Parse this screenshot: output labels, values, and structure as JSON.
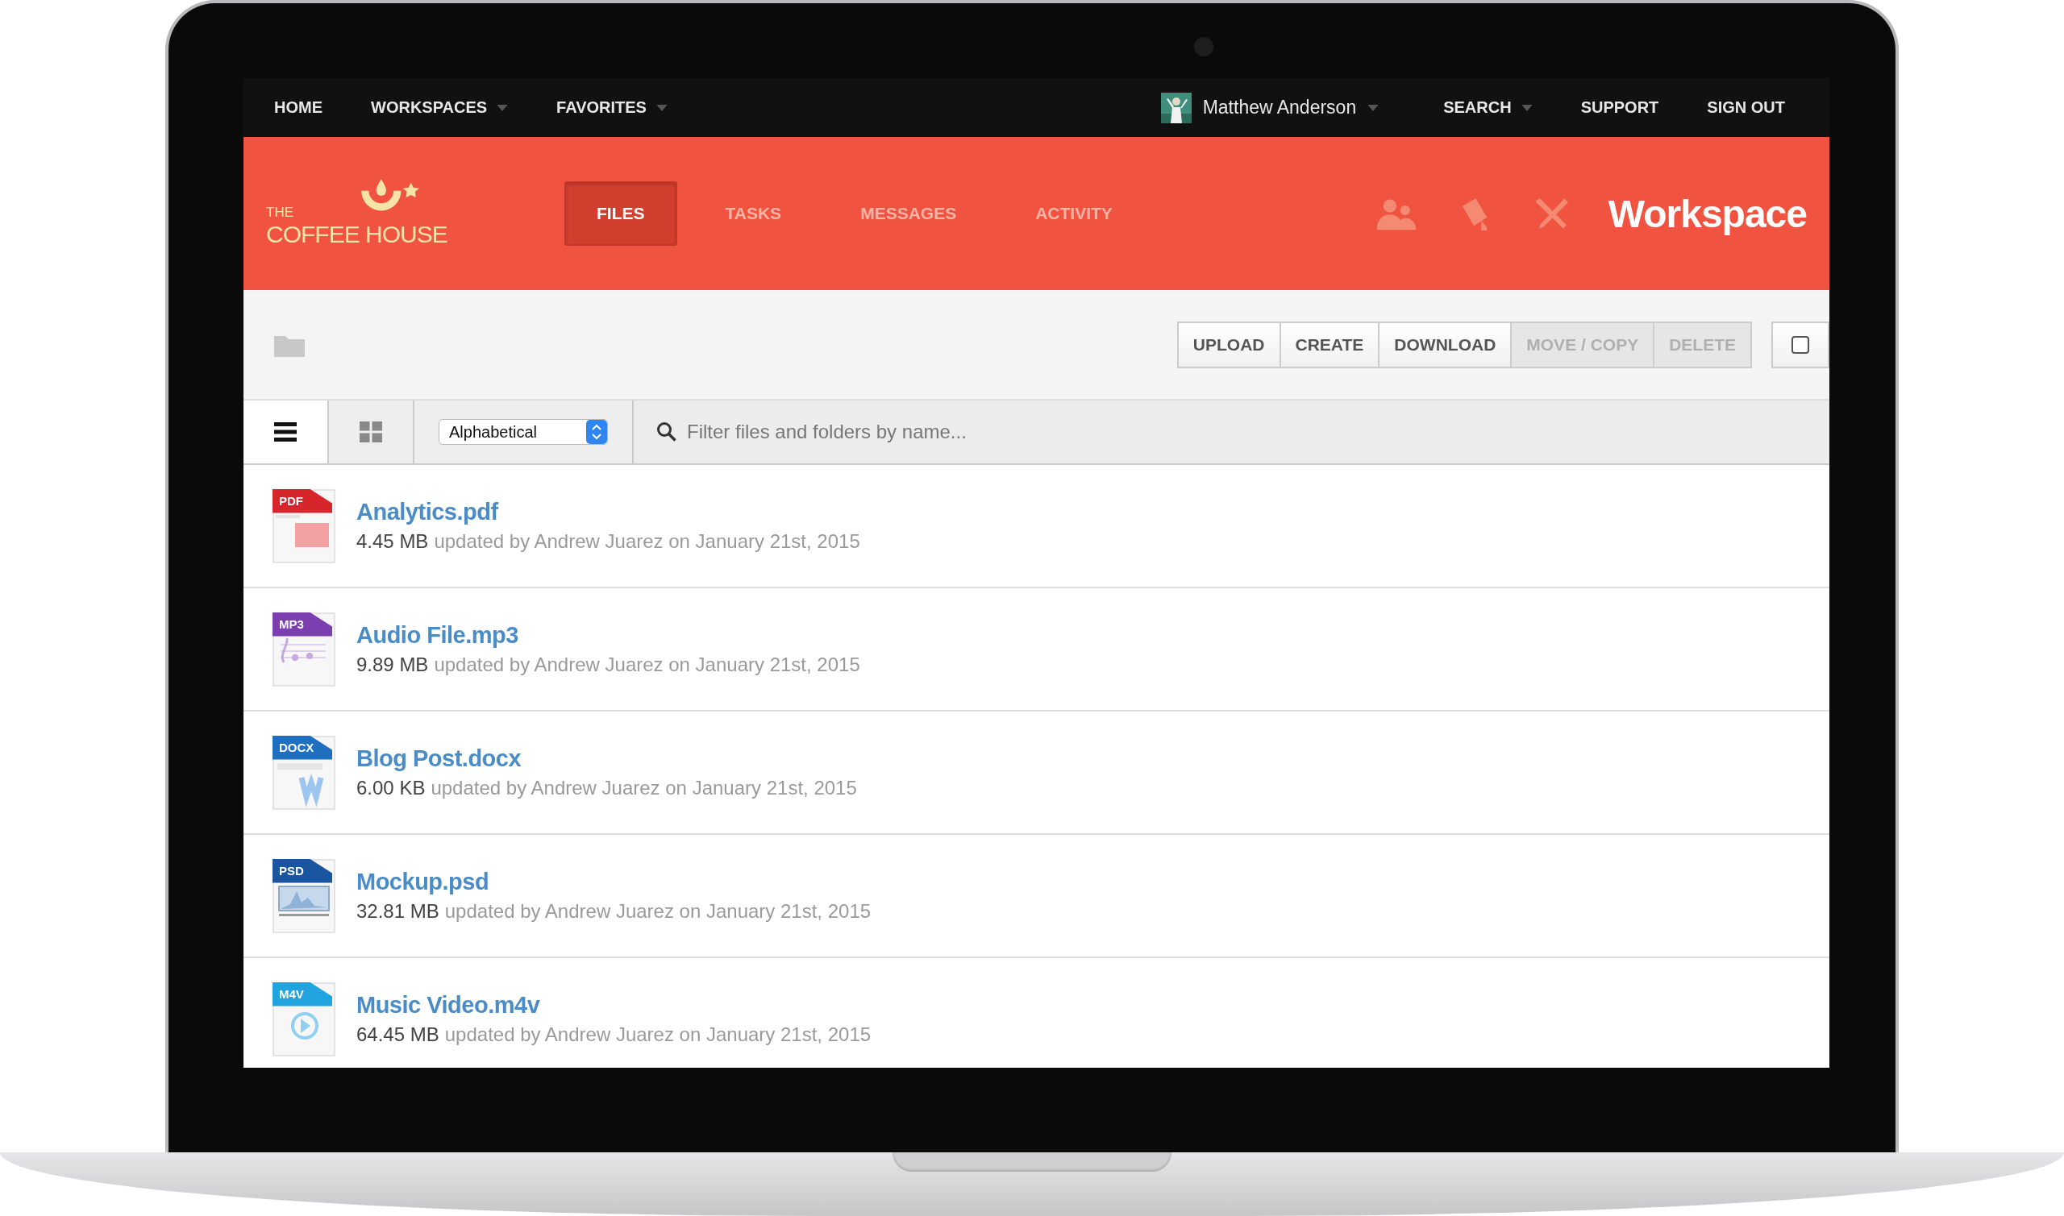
{
  "nav": {
    "left": [
      {
        "label": "HOME",
        "dropdown": false
      },
      {
        "label": "WORKSPACES",
        "dropdown": true
      },
      {
        "label": "FAVORITES",
        "dropdown": true
      }
    ],
    "user": {
      "name": "Matthew Anderson"
    },
    "right": [
      {
        "label": "SEARCH",
        "dropdown": true
      },
      {
        "label": "SUPPORT",
        "dropdown": false
      },
      {
        "label": "SIGN OUT",
        "dropdown": false
      }
    ]
  },
  "brand": {
    "prefix": "THE",
    "name": "COFFEE HOUSE"
  },
  "tabs": [
    {
      "label": "FILES",
      "selected": true
    },
    {
      "label": "TASKS",
      "selected": false
    },
    {
      "label": "MESSAGES",
      "selected": false
    },
    {
      "label": "ACTIVITY",
      "selected": false
    }
  ],
  "workspace_title": "Workspace",
  "actions": [
    {
      "label": "UPLOAD",
      "disabled": false
    },
    {
      "label": "CREATE",
      "disabled": false
    },
    {
      "label": "DOWNLOAD",
      "disabled": false
    },
    {
      "label": "MOVE / COPY",
      "disabled": true
    },
    {
      "label": "DELETE",
      "disabled": true
    }
  ],
  "select_all": {
    "checked": false
  },
  "views": [
    {
      "kind": "list",
      "selected": true
    },
    {
      "kind": "grid",
      "selected": false
    }
  ],
  "sort": {
    "value": "Alphabetical"
  },
  "filter": {
    "placeholder": "Filter files and folders by name..."
  },
  "files": [
    {
      "kind": "pdf",
      "type_label": "PDF",
      "color": "#d7262b",
      "name": "Analytics.pdf",
      "size": "4.45 MB",
      "meta": "updated by Andrew Juarez on January 21st, 2015"
    },
    {
      "kind": "mp3",
      "type_label": "MP3",
      "color": "#7b3fb0",
      "name": "Audio File.mp3",
      "size": "9.89 MB",
      "meta": "updated by Andrew Juarez on January 21st, 2015"
    },
    {
      "kind": "docx",
      "type_label": "DOCX",
      "color": "#1f6fc1",
      "name": "Blog Post.docx",
      "size": "6.00 KB",
      "meta": "updated by Andrew Juarez on January 21st, 2015"
    },
    {
      "kind": "psd",
      "type_label": "PSD",
      "color": "#1a56a0",
      "name": "Mockup.psd",
      "size": "32.81 MB",
      "meta": "updated by Andrew Juarez on January 21st, 2015"
    },
    {
      "kind": "m4v",
      "type_label": "M4V",
      "color": "#21a3e0",
      "name": "Music Video.m4v",
      "size": "64.45 MB",
      "meta": "updated by Andrew Juarez on January 21st, 2015"
    }
  ]
}
